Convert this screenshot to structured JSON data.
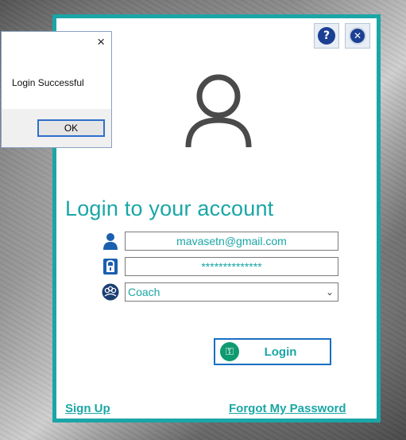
{
  "dialog": {
    "message": "Login Successful",
    "ok_label": "OK",
    "close_glyph": "×"
  },
  "panel": {
    "title": "Login to your account",
    "help_glyph": "?",
    "close_glyph": "✕",
    "email": "mavasetn@gmail.com",
    "password_masked": "**************",
    "role": "Coach",
    "login_label": "Login",
    "signup_label": "Sign Up",
    "forgot_label": "Forgot My Password",
    "key_glyph": "⚿"
  },
  "colors": {
    "accent": "#1aa6a6",
    "icon_blue": "#1b3f93",
    "login_border": "#1a6fc2",
    "key_green": "#0f9a70"
  }
}
